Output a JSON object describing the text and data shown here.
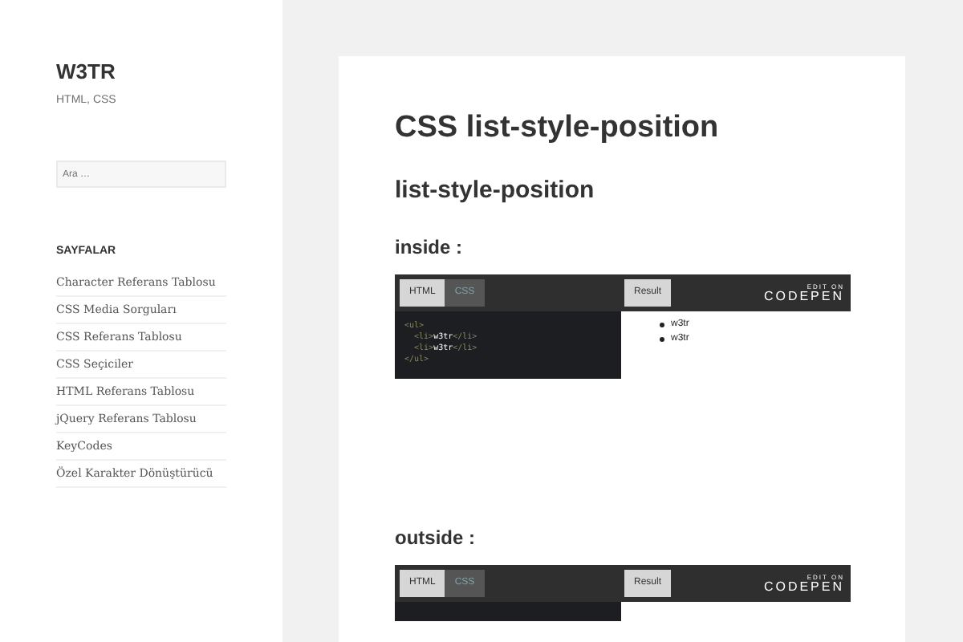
{
  "site": {
    "title": "W3TR",
    "tagline": "HTML, CSS"
  },
  "search": {
    "placeholder": "Ara …"
  },
  "sidebar": {
    "heading": "SAYFALAR",
    "items": [
      "Character Referans Tablosu",
      "CSS Media Sorguları",
      "CSS Referans Tablosu",
      "CSS Seçiciler",
      "HTML Referans Tablosu",
      "jQuery Referans Tablosu",
      "KeyCodes",
      "Özel Karakter Dönüştürücü"
    ]
  },
  "article": {
    "title": "CSS list-style-position",
    "subtitle": "list-style-position",
    "sections": [
      {
        "heading": "inside :",
        "embed": {
          "tabs": [
            {
              "label": "HTML",
              "selected": true
            },
            {
              "label": "CSS",
              "selected": false
            }
          ],
          "result": "Result",
          "brand_top": "EDIT ON",
          "brand": "CODEPEN",
          "code": [
            {
              "tag_open": "<ul>"
            },
            {
              "tag_open": "  <li>",
              "text": "w3tr",
              "tag_close": "</li>"
            },
            {
              "tag_open": "  <li>",
              "text": "w3tr",
              "tag_close": "</li>"
            },
            {
              "tag_open": "</ul>"
            }
          ],
          "items": [
            "w3tr",
            "w3tr"
          ]
        }
      },
      {
        "heading": "outside :",
        "embed": {
          "tabs": [
            {
              "label": "HTML",
              "selected": true
            },
            {
              "label": "CSS",
              "selected": false
            }
          ],
          "result": "Result",
          "brand_top": "EDIT ON",
          "brand": "CODEPEN"
        }
      }
    ]
  }
}
